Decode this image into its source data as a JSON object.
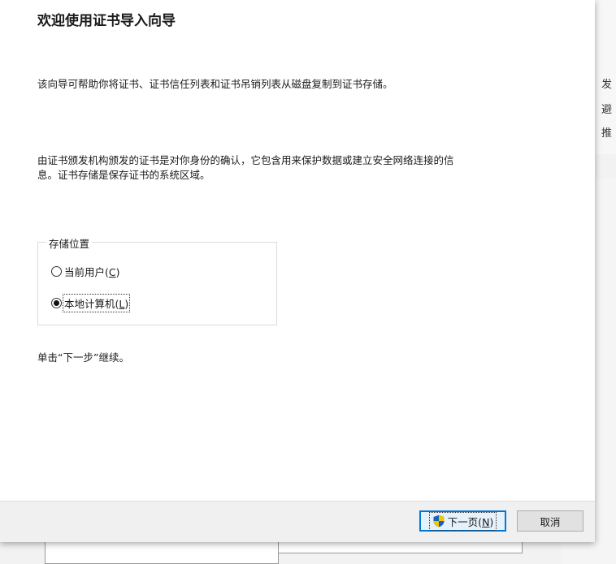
{
  "wizard": {
    "title": "欢迎使用证书导入向导",
    "intro": "该向导可帮助你将证书、证书信任列表和证书吊销列表从磁盘复制到证书存储。",
    "description_line1": "由证书颁发机构颁发的证书是对你身份的确认，它包含用来保护数据或建立安全网络连接的信",
    "description_line2": "息。证书存储是保存证书的系统区域。",
    "store_location": {
      "legend": "存储位置",
      "options": [
        {
          "label": "当前用户(",
          "mnemonic": "C",
          "suffix": ")",
          "selected": false
        },
        {
          "label": "本地计算机(",
          "mnemonic": "L",
          "suffix": ")",
          "selected": true
        }
      ]
    },
    "continue_hint": "单击“下一步”继续。",
    "buttons": {
      "next_label": "下一页(",
      "next_mnemonic": "N",
      "next_suffix": ")",
      "cancel_label": "取消"
    }
  },
  "background": {
    "right_text": [
      "发",
      "避",
      "推"
    ]
  },
  "colors": {
    "accent": "#0078d7",
    "shield_blue": "#1565c0",
    "shield_yellow": "#f5c400"
  },
  "icons": {
    "next_button_icon": "uac-shield-icon"
  }
}
